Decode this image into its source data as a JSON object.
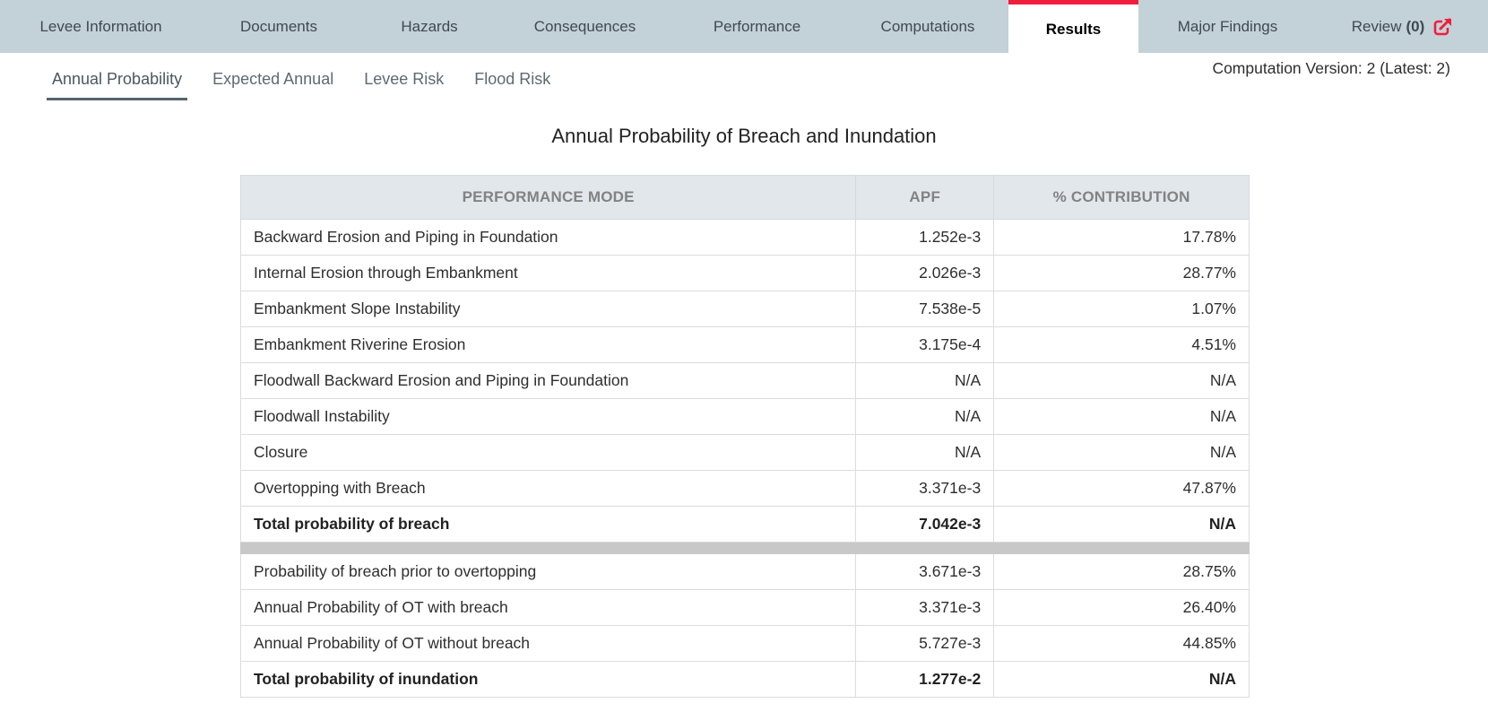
{
  "topnav": {
    "tabs": [
      {
        "label": "Levee Information"
      },
      {
        "label": "Documents"
      },
      {
        "label": "Hazards"
      },
      {
        "label": "Consequences"
      },
      {
        "label": "Performance"
      },
      {
        "label": "Computations"
      },
      {
        "label": "Results"
      },
      {
        "label": "Major Findings"
      }
    ],
    "review": {
      "label": "Review",
      "count": "(0)"
    },
    "active": "Results",
    "accent_color": "#ee1e3c"
  },
  "subtabs": {
    "items": [
      {
        "label": "Annual Probability"
      },
      {
        "label": "Expected Annual"
      },
      {
        "label": "Levee Risk"
      },
      {
        "label": "Flood Risk"
      }
    ],
    "active": "Annual Probability"
  },
  "version": "Computation Version: 2 (Latest: 2)",
  "title": "Annual Probability of Breach and Inundation",
  "table": {
    "headers": [
      "PERFORMANCE MODE",
      "APF",
      "% CONTRIBUTION"
    ],
    "rows": [
      [
        "Backward Erosion and Piping in Foundation",
        "1.252e-3",
        "17.78%"
      ],
      [
        "Internal Erosion through Embankment",
        "2.026e-3",
        "28.77%"
      ],
      [
        "Embankment Slope Instability",
        "7.538e-5",
        "1.07%"
      ],
      [
        "Embankment Riverine Erosion",
        "3.175e-4",
        "4.51%"
      ],
      [
        "Floodwall Backward Erosion and Piping in Foundation",
        "N/A",
        "N/A"
      ],
      [
        "Floodwall Instability",
        "N/A",
        "N/A"
      ],
      [
        "Closure",
        "N/A",
        "N/A"
      ],
      [
        "Overtopping with Breach",
        "3.371e-3",
        "47.87%"
      ]
    ],
    "total_breach": [
      "Total probability of breach",
      "7.042e-3",
      "N/A"
    ],
    "rows2": [
      [
        "Probability of breach prior to overtopping",
        "3.671e-3",
        "28.75%"
      ],
      [
        "Annual Probability of OT with breach",
        "3.371e-3",
        "26.40%"
      ],
      [
        "Annual Probability of OT without breach",
        "5.727e-3",
        "44.85%"
      ]
    ],
    "total_inundation": [
      "Total probability of inundation",
      "1.277e-2",
      "N/A"
    ]
  }
}
